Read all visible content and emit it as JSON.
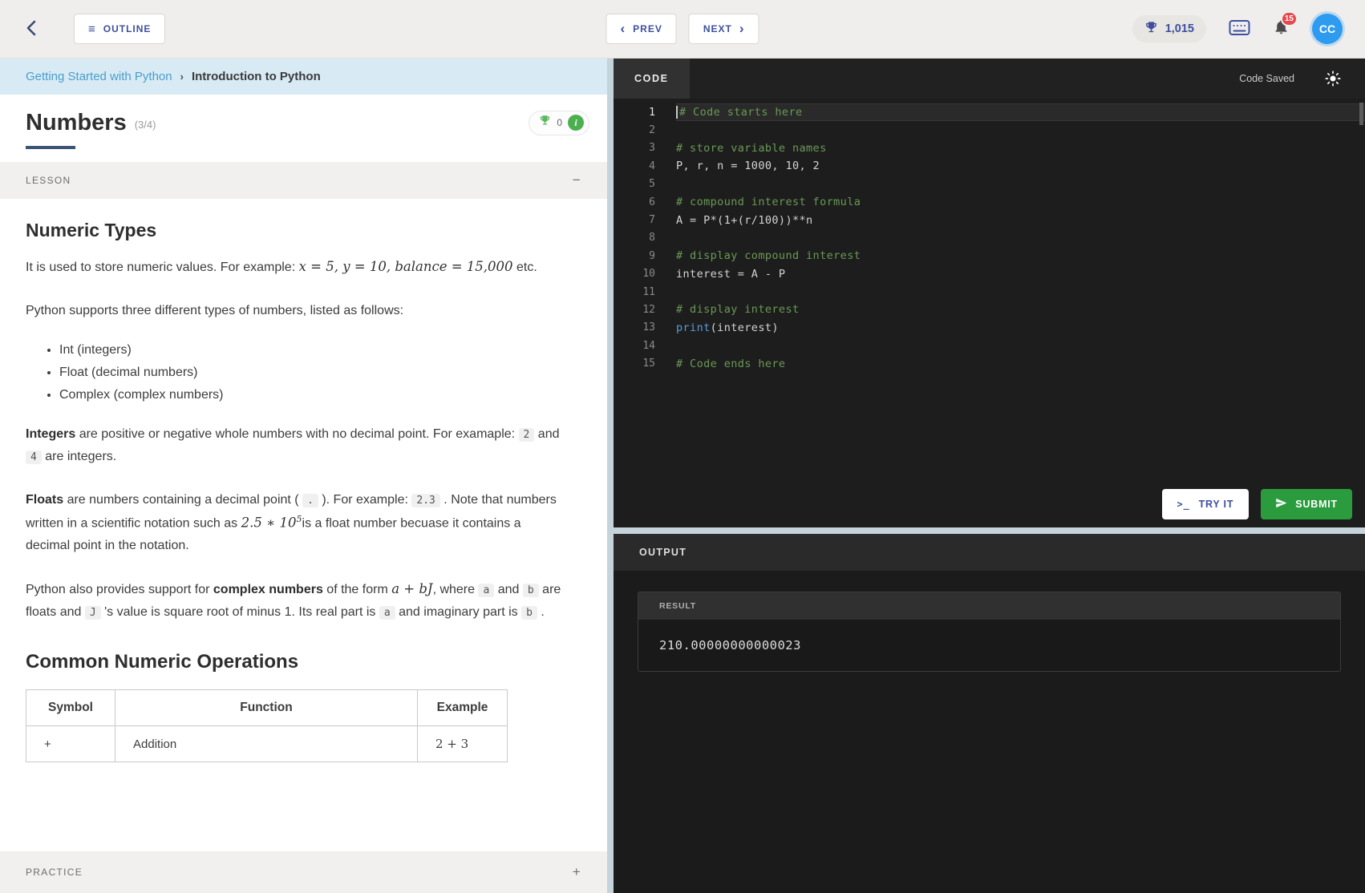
{
  "topbar": {
    "outline_label": "OUTLINE",
    "prev_label": "PREV",
    "next_label": "NEXT",
    "points": "1,015",
    "notification_count": "15",
    "avatar_initials": "CC"
  },
  "icons": {
    "hamburger": "≡",
    "chevron_left": "‹",
    "chevron_right": "›",
    "breadcrumb_sep": "›",
    "collapse": "−",
    "expand": "+",
    "prompt": ">_",
    "info": "i"
  },
  "breadcrumb": {
    "course": "Getting Started with Python",
    "lesson": "Introduction to Python"
  },
  "page": {
    "title": "Numbers",
    "progress": "(3/4)",
    "trophy_count": "0"
  },
  "lesson": {
    "label": "LESSON",
    "heading1": "Numeric Types",
    "p1": {
      "t1": "It is used to store numeric values. For example: ",
      "m1": "x = 5, y = 10, balance = 15,000",
      "t2": " etc."
    },
    "p2": "Python supports three different types of numbers, listed as follows:",
    "bullets": [
      "Int (integers)",
      "Float (decimal numbers)",
      "Complex (complex numbers)"
    ],
    "p3": {
      "b1": "Integers",
      "t1": " are positive or negative whole numbers with no decimal point. For examaple: ",
      "c1": "2",
      "t2": " and ",
      "c2": "4",
      "t3": " are integers."
    },
    "p4": {
      "b1": "Floats",
      "t1": " are numbers containing a decimal point ( ",
      "c1": ".",
      "t2": " ). For example: ",
      "c2": "2.3",
      "t3": " . Note that numbers written in a scientific notation such as ",
      "m1": "2.5 ∗ 10",
      "m1_sup": "5",
      "t4": "is a float number becuase it contains a decimal point in the notation."
    },
    "p5": {
      "t1": "Python also provides support for ",
      "b1": "complex numbers",
      "t2": " of the form ",
      "m1": "a + bJ",
      "t3": ", where ",
      "c1": "a",
      "t4": " and ",
      "c2": "b",
      "t5": " are floats and ",
      "c3": "J",
      "t6": " 's value is square root of minus 1. Its real part is ",
      "c4": "a",
      "t7": " and imaginary part is ",
      "c5": "b",
      "t8": " ."
    },
    "heading2": "Common Numeric Operations",
    "table": {
      "headers": [
        "Symbol",
        "Function",
        "Example"
      ],
      "rows": [
        {
          "symbol": "+",
          "function": "Addition",
          "example": "2 + 3"
        }
      ]
    }
  },
  "practice": {
    "label": "PRACTICE"
  },
  "code_panel": {
    "tab": "CODE",
    "status": "Code Saved",
    "try_label": "TRY IT",
    "submit_label": "SUBMIT",
    "lines": [
      {
        "n": "1",
        "text": "# Code starts here"
      },
      {
        "n": "2",
        "text": ""
      },
      {
        "n": "3",
        "text": "# store variable names"
      },
      {
        "n": "4",
        "text": "P, r, n = 1000, 10, 2"
      },
      {
        "n": "5",
        "text": ""
      },
      {
        "n": "6",
        "text": "# compound interest formula"
      },
      {
        "n": "7",
        "text": "A = P*(1+(r/100))**n"
      },
      {
        "n": "8",
        "text": ""
      },
      {
        "n": "9",
        "text": "# display compound interest"
      },
      {
        "n": "10",
        "text": "interest = A - P"
      },
      {
        "n": "11",
        "text": ""
      },
      {
        "n": "12",
        "text": "# display interest"
      },
      {
        "n": "13",
        "kw": "print",
        "rest": "(interest)"
      },
      {
        "n": "14",
        "text": ""
      },
      {
        "n": "15",
        "text": "# Code ends here"
      }
    ]
  },
  "output_panel": {
    "title": "OUTPUT",
    "result_label": "RESULT",
    "result_value": "210.00000000000023"
  },
  "colors": {
    "accent_indigo": "#3d4f9e",
    "link_blue": "#4b9dcb",
    "success_green": "#2b9c3e",
    "avatar_blue": "#2d9cf0",
    "badge_red": "#e5484d",
    "comment_green": "#6a9955",
    "keyword_blue": "#569cd6"
  }
}
